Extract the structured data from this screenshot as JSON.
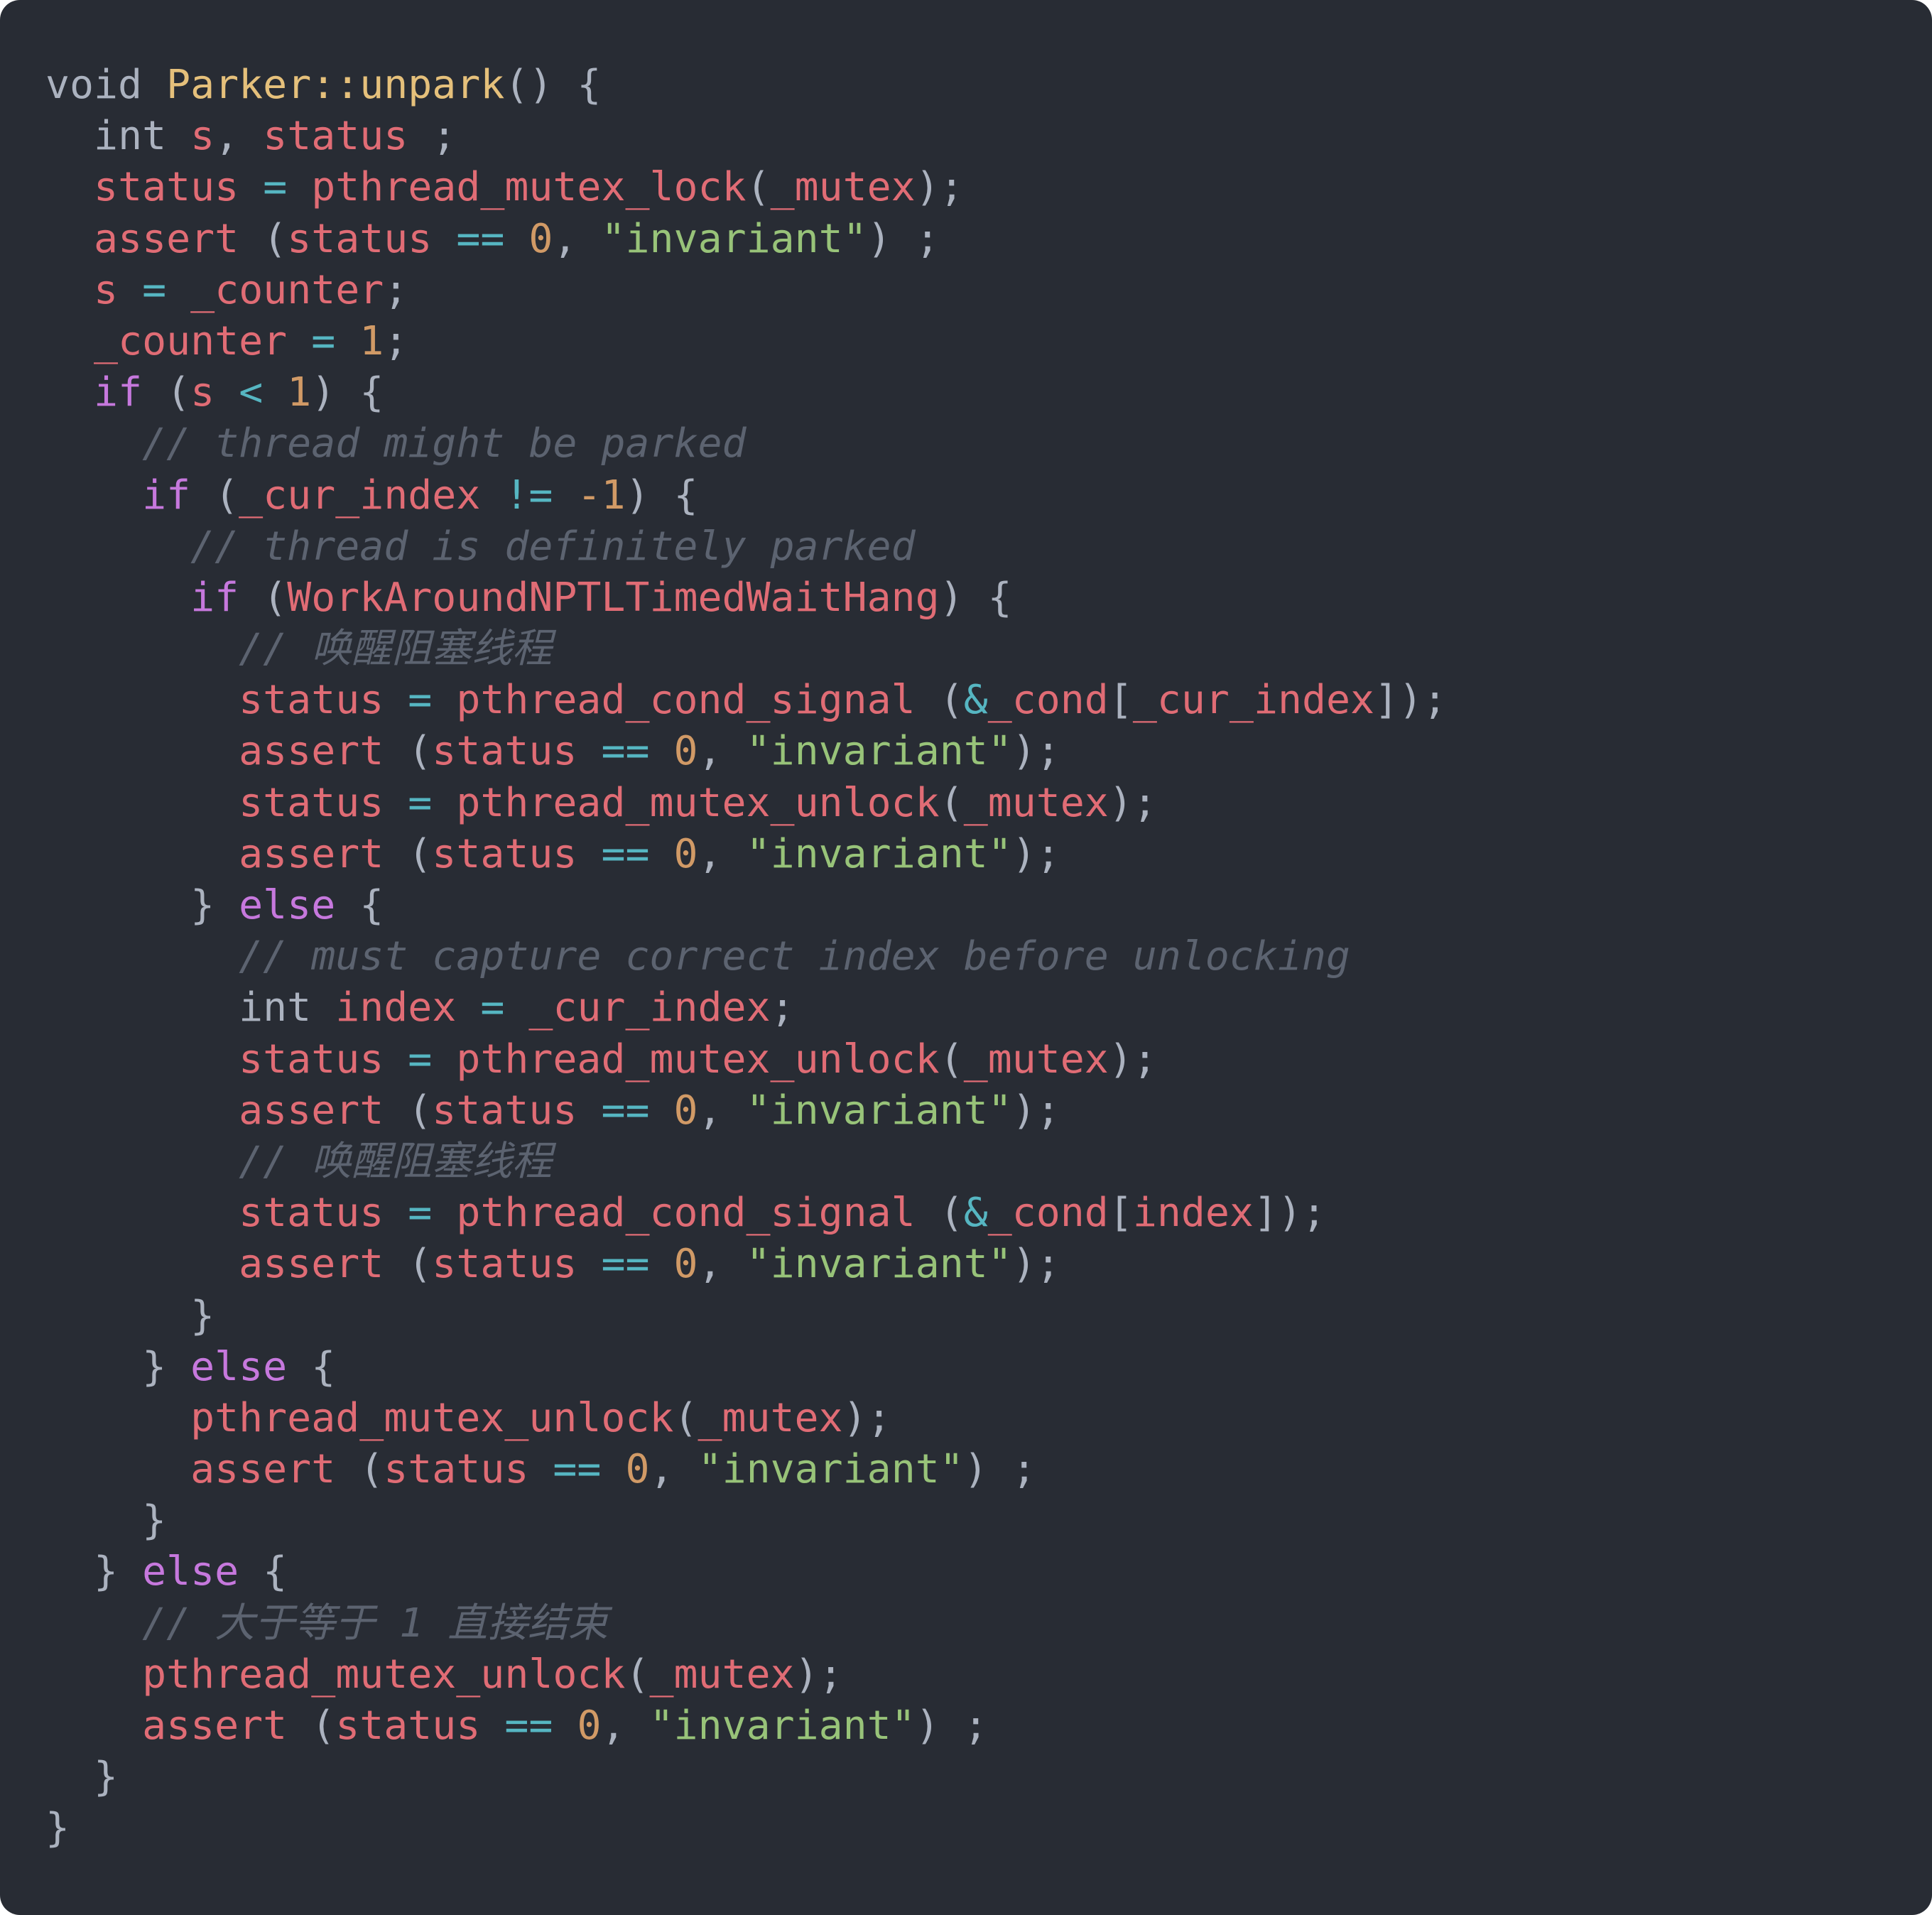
{
  "colors": {
    "background": "#282c34",
    "plain": "#abb2bf",
    "keyword": "#c678dd",
    "function_name": "#e5c07b",
    "variable": "#e06c75",
    "operator": "#56b6c2",
    "number": "#d19a66",
    "string": "#98c379",
    "comment": "#5c6370"
  },
  "code": {
    "language": "cpp",
    "lines": [
      [
        [
          "type",
          "void"
        ],
        [
          "plain",
          " "
        ],
        [
          "fn",
          "Parker::unpark"
        ],
        [
          "plain",
          "() {"
        ]
      ],
      [
        [
          "plain",
          "  "
        ],
        [
          "type",
          "int"
        ],
        [
          "plain",
          " "
        ],
        [
          "var",
          "s"
        ],
        [
          "plain",
          ", "
        ],
        [
          "var",
          "status"
        ],
        [
          "plain",
          " ;"
        ]
      ],
      [
        [
          "plain",
          "  "
        ],
        [
          "var",
          "status"
        ],
        [
          "plain",
          " "
        ],
        [
          "op",
          "="
        ],
        [
          "plain",
          " "
        ],
        [
          "var",
          "pthread_mutex_lock"
        ],
        [
          "plain",
          "("
        ],
        [
          "var",
          "_mutex"
        ],
        [
          "plain",
          ");"
        ]
      ],
      [
        [
          "plain",
          "  "
        ],
        [
          "var",
          "assert"
        ],
        [
          "plain",
          " ("
        ],
        [
          "var",
          "status"
        ],
        [
          "plain",
          " "
        ],
        [
          "op",
          "=="
        ],
        [
          "plain",
          " "
        ],
        [
          "num",
          "0"
        ],
        [
          "plain",
          ", "
        ],
        [
          "str",
          "\"invariant\""
        ],
        [
          "plain",
          ") ;"
        ]
      ],
      [
        [
          "plain",
          "  "
        ],
        [
          "var",
          "s"
        ],
        [
          "plain",
          " "
        ],
        [
          "op",
          "="
        ],
        [
          "plain",
          " "
        ],
        [
          "var",
          "_counter"
        ],
        [
          "plain",
          ";"
        ]
      ],
      [
        [
          "plain",
          "  "
        ],
        [
          "var",
          "_counter"
        ],
        [
          "plain",
          " "
        ],
        [
          "op",
          "="
        ],
        [
          "plain",
          " "
        ],
        [
          "num",
          "1"
        ],
        [
          "plain",
          ";"
        ]
      ],
      [
        [
          "plain",
          "  "
        ],
        [
          "kw",
          "if"
        ],
        [
          "plain",
          " ("
        ],
        [
          "var",
          "s"
        ],
        [
          "plain",
          " "
        ],
        [
          "op",
          "<"
        ],
        [
          "plain",
          " "
        ],
        [
          "num",
          "1"
        ],
        [
          "plain",
          ") {"
        ]
      ],
      [
        [
          "plain",
          "    "
        ],
        [
          "com",
          "// thread might be parked"
        ]
      ],
      [
        [
          "plain",
          "    "
        ],
        [
          "kw",
          "if"
        ],
        [
          "plain",
          " ("
        ],
        [
          "var",
          "_cur_index"
        ],
        [
          "plain",
          " "
        ],
        [
          "op",
          "!="
        ],
        [
          "plain",
          " "
        ],
        [
          "num",
          "-1"
        ],
        [
          "plain",
          ") {"
        ]
      ],
      [
        [
          "plain",
          "      "
        ],
        [
          "com",
          "// thread is definitely parked"
        ]
      ],
      [
        [
          "plain",
          "      "
        ],
        [
          "kw",
          "if"
        ],
        [
          "plain",
          " ("
        ],
        [
          "var",
          "WorkAroundNPTLTimedWaitHang"
        ],
        [
          "plain",
          ") {"
        ]
      ],
      [
        [
          "plain",
          "        "
        ],
        [
          "com",
          "// 唤醒阻塞线程"
        ]
      ],
      [
        [
          "plain",
          "        "
        ],
        [
          "var",
          "status"
        ],
        [
          "plain",
          " "
        ],
        [
          "op",
          "="
        ],
        [
          "plain",
          " "
        ],
        [
          "var",
          "pthread_cond_signal"
        ],
        [
          "plain",
          " ("
        ],
        [
          "op",
          "&"
        ],
        [
          "var",
          "_cond"
        ],
        [
          "plain",
          "["
        ],
        [
          "var",
          "_cur_index"
        ],
        [
          "plain",
          "]);"
        ]
      ],
      [
        [
          "plain",
          "        "
        ],
        [
          "var",
          "assert"
        ],
        [
          "plain",
          " ("
        ],
        [
          "var",
          "status"
        ],
        [
          "plain",
          " "
        ],
        [
          "op",
          "=="
        ],
        [
          "plain",
          " "
        ],
        [
          "num",
          "0"
        ],
        [
          "plain",
          ", "
        ],
        [
          "str",
          "\"invariant\""
        ],
        [
          "plain",
          ");"
        ]
      ],
      [
        [
          "plain",
          "        "
        ],
        [
          "var",
          "status"
        ],
        [
          "plain",
          " "
        ],
        [
          "op",
          "="
        ],
        [
          "plain",
          " "
        ],
        [
          "var",
          "pthread_mutex_unlock"
        ],
        [
          "plain",
          "("
        ],
        [
          "var",
          "_mutex"
        ],
        [
          "plain",
          ");"
        ]
      ],
      [
        [
          "plain",
          "        "
        ],
        [
          "var",
          "assert"
        ],
        [
          "plain",
          " ("
        ],
        [
          "var",
          "status"
        ],
        [
          "plain",
          " "
        ],
        [
          "op",
          "=="
        ],
        [
          "plain",
          " "
        ],
        [
          "num",
          "0"
        ],
        [
          "plain",
          ", "
        ],
        [
          "str",
          "\"invariant\""
        ],
        [
          "plain",
          ");"
        ]
      ],
      [
        [
          "plain",
          "      } "
        ],
        [
          "kw",
          "else"
        ],
        [
          "plain",
          " {"
        ]
      ],
      [
        [
          "plain",
          "        "
        ],
        [
          "com",
          "// must capture correct index before unlocking"
        ]
      ],
      [
        [
          "plain",
          "        "
        ],
        [
          "type",
          "int"
        ],
        [
          "plain",
          " "
        ],
        [
          "var",
          "index"
        ],
        [
          "plain",
          " "
        ],
        [
          "op",
          "="
        ],
        [
          "plain",
          " "
        ],
        [
          "var",
          "_cur_index"
        ],
        [
          "plain",
          ";"
        ]
      ],
      [
        [
          "plain",
          "        "
        ],
        [
          "var",
          "status"
        ],
        [
          "plain",
          " "
        ],
        [
          "op",
          "="
        ],
        [
          "plain",
          " "
        ],
        [
          "var",
          "pthread_mutex_unlock"
        ],
        [
          "plain",
          "("
        ],
        [
          "var",
          "_mutex"
        ],
        [
          "plain",
          ");"
        ]
      ],
      [
        [
          "plain",
          "        "
        ],
        [
          "var",
          "assert"
        ],
        [
          "plain",
          " ("
        ],
        [
          "var",
          "status"
        ],
        [
          "plain",
          " "
        ],
        [
          "op",
          "=="
        ],
        [
          "plain",
          " "
        ],
        [
          "num",
          "0"
        ],
        [
          "plain",
          ", "
        ],
        [
          "str",
          "\"invariant\""
        ],
        [
          "plain",
          ");"
        ]
      ],
      [
        [
          "plain",
          "        "
        ],
        [
          "com",
          "// 唤醒阻塞线程"
        ]
      ],
      [
        [
          "plain",
          "        "
        ],
        [
          "var",
          "status"
        ],
        [
          "plain",
          " "
        ],
        [
          "op",
          "="
        ],
        [
          "plain",
          " "
        ],
        [
          "var",
          "pthread_cond_signal"
        ],
        [
          "plain",
          " ("
        ],
        [
          "op",
          "&"
        ],
        [
          "var",
          "_cond"
        ],
        [
          "plain",
          "["
        ],
        [
          "var",
          "index"
        ],
        [
          "plain",
          "]);"
        ]
      ],
      [
        [
          "plain",
          "        "
        ],
        [
          "var",
          "assert"
        ],
        [
          "plain",
          " ("
        ],
        [
          "var",
          "status"
        ],
        [
          "plain",
          " "
        ],
        [
          "op",
          "=="
        ],
        [
          "plain",
          " "
        ],
        [
          "num",
          "0"
        ],
        [
          "plain",
          ", "
        ],
        [
          "str",
          "\"invariant\""
        ],
        [
          "plain",
          ");"
        ]
      ],
      [
        [
          "plain",
          "      }"
        ]
      ],
      [
        [
          "plain",
          "    } "
        ],
        [
          "kw",
          "else"
        ],
        [
          "plain",
          " {"
        ]
      ],
      [
        [
          "plain",
          "      "
        ],
        [
          "var",
          "pthread_mutex_unlock"
        ],
        [
          "plain",
          "("
        ],
        [
          "var",
          "_mutex"
        ],
        [
          "plain",
          ");"
        ]
      ],
      [
        [
          "plain",
          "      "
        ],
        [
          "var",
          "assert"
        ],
        [
          "plain",
          " ("
        ],
        [
          "var",
          "status"
        ],
        [
          "plain",
          " "
        ],
        [
          "op",
          "=="
        ],
        [
          "plain",
          " "
        ],
        [
          "num",
          "0"
        ],
        [
          "plain",
          ", "
        ],
        [
          "str",
          "\"invariant\""
        ],
        [
          "plain",
          ") ;"
        ]
      ],
      [
        [
          "plain",
          "    }"
        ]
      ],
      [
        [
          "plain",
          "  } "
        ],
        [
          "kw",
          "else"
        ],
        [
          "plain",
          " {"
        ]
      ],
      [
        [
          "plain",
          "    "
        ],
        [
          "com",
          "// 大于等于 1 直接结束"
        ]
      ],
      [
        [
          "plain",
          "    "
        ],
        [
          "var",
          "pthread_mutex_unlock"
        ],
        [
          "plain",
          "("
        ],
        [
          "var",
          "_mutex"
        ],
        [
          "plain",
          ");"
        ]
      ],
      [
        [
          "plain",
          "    "
        ],
        [
          "var",
          "assert"
        ],
        [
          "plain",
          " ("
        ],
        [
          "var",
          "status"
        ],
        [
          "plain",
          " "
        ],
        [
          "op",
          "=="
        ],
        [
          "plain",
          " "
        ],
        [
          "num",
          "0"
        ],
        [
          "plain",
          ", "
        ],
        [
          "str",
          "\"invariant\""
        ],
        [
          "plain",
          ") ;"
        ]
      ],
      [
        [
          "plain",
          "  }"
        ]
      ],
      [
        [
          "plain",
          "}"
        ]
      ]
    ]
  }
}
